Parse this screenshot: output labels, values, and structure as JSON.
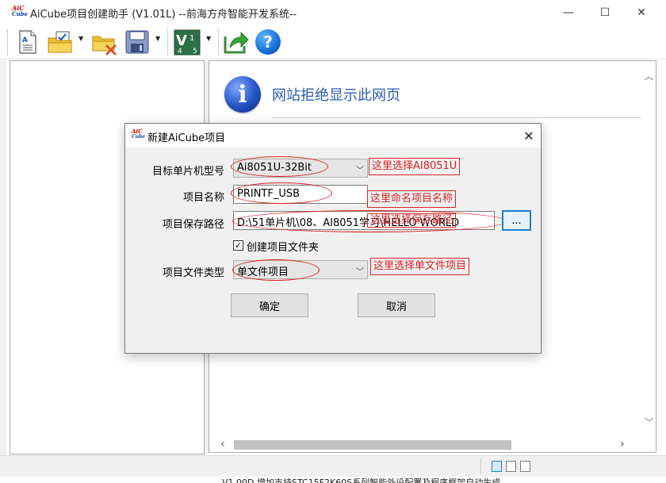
{
  "window": {
    "title": "AiCube项目创建助手 (V1.01L) --前海方舟智能开发系统--",
    "logo_top": "AiC",
    "logo_bottom": "Cube",
    "minimize": "—",
    "maximize": "☐",
    "close": "✕"
  },
  "toolbar": {
    "icons": [
      "new-document-icon",
      "open-project-icon",
      "delete-project-icon",
      "save-icon",
      "version-icon",
      "export-icon",
      "help-icon"
    ],
    "version_label": "V",
    "help_label": "?"
  },
  "browser": {
    "message": "网站拒绝显示此网页",
    "info_glyph": "i"
  },
  "dialog": {
    "title": "新建AiCube项目",
    "close": "✕",
    "mcu_label": "目标单片机型号",
    "mcu_value": "Ai8051U-32Bit",
    "name_label": "项目名称",
    "name_value": "PRINTF_USB",
    "path_label": "项目保存路径",
    "path_value": "D:\\51单片机\\08、AI8051学习\\HELLO WORLD",
    "browse_label": "...",
    "create_folder_label": "创建项目文件夹",
    "create_folder_checked": true,
    "type_label": "项目文件类型",
    "type_value": "单文件项目",
    "ok_label": "确定",
    "cancel_label": "取消"
  },
  "annotations": {
    "mcu": "这里选择AI8051U",
    "name": "这里命名项目名称",
    "path": "这里选择保存路径",
    "type": "这里选择单文件项目"
  },
  "bottom_text": "V1.00D    增加支持STC15F2K60S系列智能外设配置及程序框架自动生成"
}
